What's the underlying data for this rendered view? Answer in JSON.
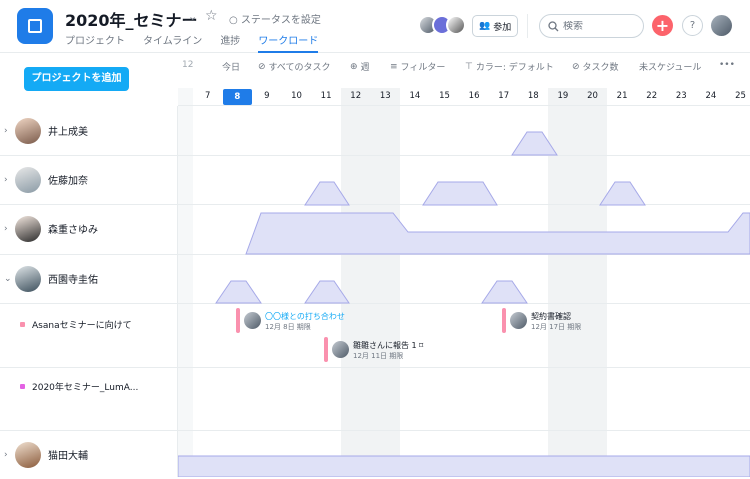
{
  "header": {
    "project_title": "2020年_セミナー",
    "status_label": "ステータスを設定",
    "tabs": [
      "プロジェクト",
      "タイムライン",
      "進捗",
      "ワークロード"
    ],
    "active_tab": "ワークロード",
    "join_label": "参加",
    "search_placeholder": "検索",
    "help_label": "?"
  },
  "toolbar": {
    "prev_date": "12",
    "today": "今日",
    "all_tasks": "すべてのタスク",
    "week": "週",
    "filter": "フィルター",
    "color": "カラー: デフォルト",
    "task_count": "タスク数",
    "unscheduled": "未スケジュール",
    "more": "•••"
  },
  "add_project_label": "プロジェクトを追加",
  "timeline": {
    "dates": [
      "7",
      "8",
      "9",
      "10",
      "11",
      "12",
      "13",
      "14",
      "15",
      "16",
      "17",
      "18",
      "19",
      "20",
      "21",
      "22",
      "23",
      "24",
      "25"
    ],
    "today": "8",
    "weekend_dates": [
      "12",
      "13",
      "19",
      "20"
    ]
  },
  "people": [
    {
      "name": "井上成美"
    },
    {
      "name": "佐藤加奈"
    },
    {
      "name": "森重さゆみ"
    },
    {
      "name": "西園寺圭佑"
    },
    {
      "name": "猫田大輔"
    }
  ],
  "projects": [
    {
      "name": "Asanaセミナーに向けて",
      "color": "#fa91ae"
    },
    {
      "name": "2020年セミナー_LumA...",
      "color": "#e362e3"
    }
  ],
  "tasks": [
    {
      "title": "〇〇様との打ち合わせ",
      "date": "12月 8日 期限",
      "link": true
    },
    {
      "title": "雛雛さんに報告 1 ⌑",
      "date": "12月 11日 期限",
      "link": false
    },
    {
      "title": "契約書確認",
      "date": "12月 17日 期限",
      "link": false
    }
  ],
  "colors": {
    "accent": "#1f7ce8",
    "add_button": "#14aaf5",
    "workload_fill": "#dfe1f7",
    "workload_stroke": "#a6a9e8",
    "task_bar": "#fa91ae"
  }
}
